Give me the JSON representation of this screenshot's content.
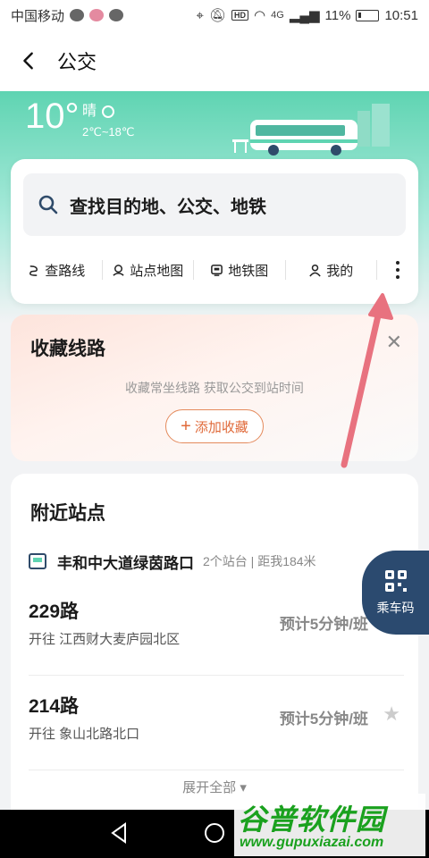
{
  "status_bar": {
    "carrier": "中国移动",
    "network": "4G",
    "battery": "11%",
    "time": "10:51"
  },
  "header": {
    "title": "公交"
  },
  "weather": {
    "temperature": "10°",
    "condition": "晴",
    "range": "2℃~18℃"
  },
  "search": {
    "placeholder": "查找目的地、公交、地铁"
  },
  "quick_actions": [
    {
      "label": "查路线",
      "icon": "route-icon"
    },
    {
      "label": "站点地图",
      "icon": "location-pin-icon"
    },
    {
      "label": "地铁图",
      "icon": "subway-icon"
    },
    {
      "label": "我的",
      "icon": "user-icon"
    }
  ],
  "favorites": {
    "title": "收藏线路",
    "description": "收藏常坐线路 获取公交到站时间",
    "add_label": "添加收藏"
  },
  "nearby": {
    "title": "附近站点",
    "stop_name": "丰和中大道绿茵路口",
    "stop_meta": "2个站台 | 距我184米",
    "routes": [
      {
        "number": "229路",
        "destination": "开往 江西财大麦庐园北区",
        "eta": "预计5分钟/班"
      },
      {
        "number": "214路",
        "destination": "开往 象山北路北口",
        "eta": "预计5分钟/班"
      }
    ],
    "expand_label": "展开全部"
  },
  "ride_code": {
    "label": "乘车码"
  },
  "watermark": {
    "brand": "谷普软件园",
    "url": "www.gupuxiazai.com"
  },
  "colors": {
    "accent": "#5fd4b2",
    "ride_code_bg": "#2b4a6f",
    "fav_button": "#e06a3a",
    "annotation_arrow": "#e8727f"
  }
}
